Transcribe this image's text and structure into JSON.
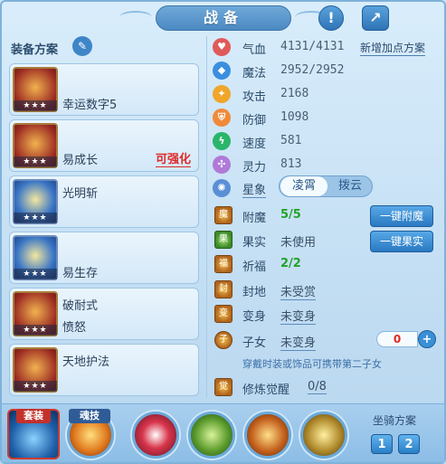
{
  "title": "战备",
  "header_icons": [
    "alert-icon",
    "share-icon"
  ],
  "left": {
    "title": "装备方案",
    "items": [
      {
        "name": "幸运数字5",
        "stars": "★★★",
        "tag": ""
      },
      {
        "name": "易成长",
        "stars": "★★★",
        "tag": "可强化"
      },
      {
        "name": "光明斩",
        "stars": "★★★",
        "tag": ""
      },
      {
        "name": "易生存",
        "stars": "★★★",
        "tag": ""
      },
      {
        "name": "破耐式",
        "name2": "愤怒",
        "stars": "★★★",
        "tag": ""
      },
      {
        "name": "天地护法",
        "stars": "★★★",
        "tag": ""
      }
    ]
  },
  "attrs": [
    {
      "label": "气血",
      "value": "4131/4131",
      "icon": "heart-icon",
      "color": "#e05a5a"
    },
    {
      "label": "魔法",
      "value": "2952/2952",
      "icon": "mana-icon",
      "color": "#3a8fe0"
    },
    {
      "label": "攻击",
      "value": "2168",
      "icon": "attack-icon",
      "color": "#f0a62a"
    },
    {
      "label": "防御",
      "value": "1098",
      "icon": "defense-icon",
      "color": "#f08a3a"
    },
    {
      "label": "速度",
      "value": "581",
      "icon": "speed-icon",
      "color": "#2ab56a"
    },
    {
      "label": "灵力",
      "value": "813",
      "icon": "spirit-icon",
      "color": "#b07ad8"
    }
  ],
  "add_points": "新增加点方案",
  "xingxiang": {
    "label": "星象",
    "opt1": "凌霄",
    "opt2": "拨云"
  },
  "sub": [
    {
      "label": "附魔",
      "value": "5/5"
    },
    {
      "label": "果实",
      "value": "未使用"
    },
    {
      "label": "祈福",
      "value": "2/2"
    },
    {
      "label": "封地",
      "value": "未受赏"
    },
    {
      "label": "变身",
      "value": "未变身"
    },
    {
      "label": "子女",
      "value": "未变身"
    }
  ],
  "btn_enchant": "一键附魔",
  "btn_fruit": "一键果实",
  "counter": "0",
  "hint": "穿戴时装或饰品可携带第二子女",
  "awaken": {
    "label": "修炼觉醒",
    "value": "0/8"
  },
  "bottom": {
    "set_label": "套装",
    "soul_label": "魂技",
    "mount_title": "坐骑方案",
    "mount1": "1",
    "mount2": "2"
  }
}
